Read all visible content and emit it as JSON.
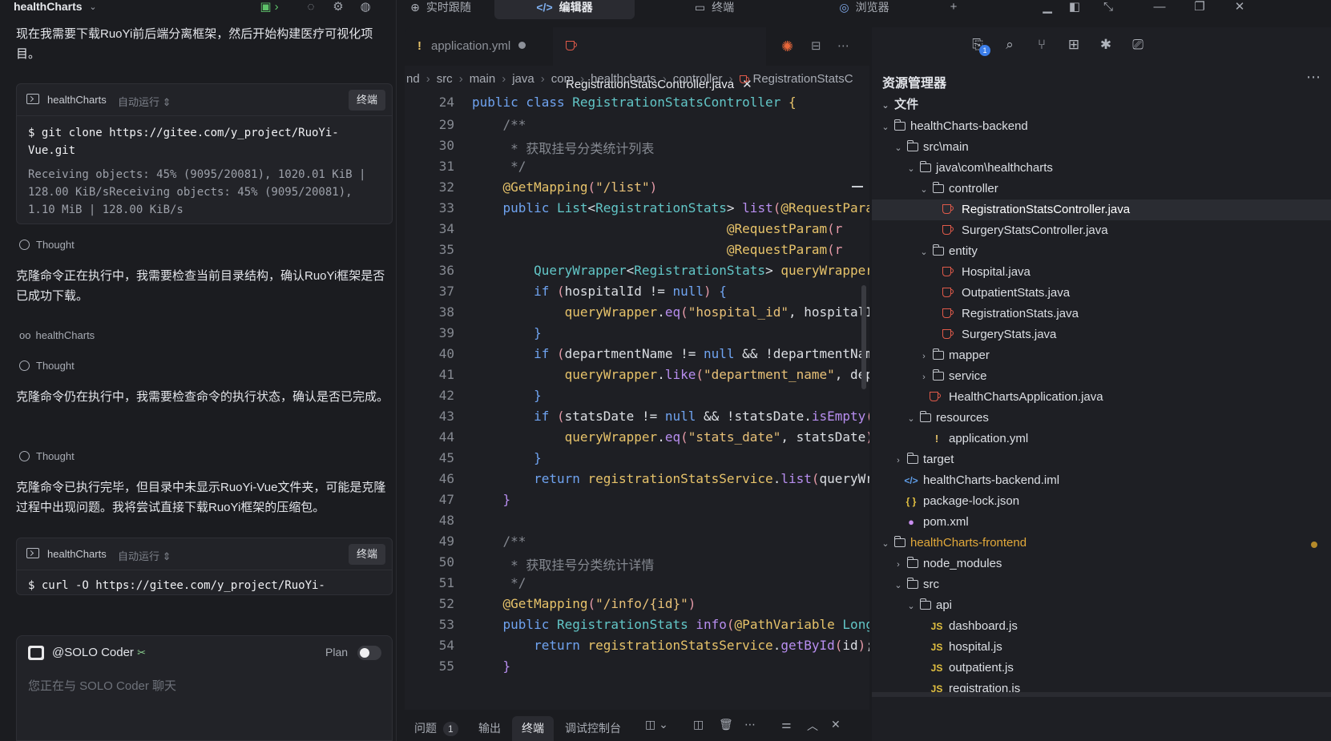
{
  "chat": {
    "title": "healthCharts",
    "message_user": "现在我需要下载RuoYi前后端分离框架，然后开始构建医疗可视化项目。",
    "term1": {
      "name": "healthCharts",
      "mode": "自动运行",
      "button": "终端",
      "cmd": "$ git clone https://gitee.com/y_project/RuoYi-Vue.git",
      "output": "Receiving objects:  45% (9095/20081), 1020.01 KiB | 128.00 KiB/sReceiving objects:  45% (9095/20081), 1.10 MiB | 128.00 KiB/s"
    },
    "thought_label": "Thought",
    "msg1": "克隆命令正在执行中，我需要检查当前目录结构，确认RuoYi框架是否已成功下载。",
    "agent_label": "healthCharts",
    "msg2": "克隆命令仍在执行中，我需要检查命令的执行状态，确认是否已完成。",
    "msg3": "克隆命令已执行完毕，但目录中未显示RuoYi-Vue文件夹，可能是克隆过程中出现问题。我将尝试直接下载RuoYi框架的压缩包。",
    "term2": {
      "name": "healthCharts",
      "mode": "自动运行",
      "button": "终端",
      "cmd": "$ curl -O https://gitee.com/y_project/RuoYi-"
    },
    "input": {
      "agent": "@SOLO Coder",
      "plan_label": "Plan",
      "plan_on": false,
      "placeholder": "您正在与 SOLO Coder 聊天"
    }
  },
  "topbar": {
    "tabs": [
      {
        "label": "实时跟随",
        "icon": "follow-icon"
      },
      {
        "label": "编辑器",
        "icon": "code-icon",
        "active": true
      },
      {
        "label": "终端",
        "icon": "terminal-icon"
      },
      {
        "label": "浏览器",
        "icon": "browser-icon"
      }
    ],
    "add": "+"
  },
  "editor": {
    "tabs": [
      {
        "label": "application.yml",
        "modified": true
      },
      {
        "label": "RegistrationStatsController.java",
        "active": true
      }
    ],
    "breadcrumb": [
      "nd",
      "src",
      "main",
      "java",
      "com",
      "healthcharts",
      "controller",
      "RegistrationStatsC"
    ],
    "lines": [
      24,
      29,
      30,
      31,
      32,
      33,
      34,
      35,
      36,
      37,
      38,
      39,
      40,
      41,
      42,
      43,
      44,
      45,
      46,
      47,
      48,
      49,
      50,
      51,
      52,
      53,
      54,
      55
    ],
    "panel_tabs": [
      {
        "label": "问题",
        "badge": "1"
      },
      {
        "label": "输出"
      },
      {
        "label": "终端",
        "active": true
      },
      {
        "label": "调试控制台"
      }
    ]
  },
  "explorer": {
    "title": "资源管理器",
    "section": "文件",
    "badge": "1",
    "tree": [
      {
        "label": "healthCharts-backend",
        "kind": "folder",
        "open": true
      },
      {
        "label": "src\\main",
        "kind": "folder",
        "open": true
      },
      {
        "label": "java\\com\\healthcharts",
        "kind": "folder",
        "open": true
      },
      {
        "label": "controller",
        "kind": "folder",
        "open": true
      },
      {
        "label": "RegistrationStatsController.java",
        "kind": "java",
        "selected": true
      },
      {
        "label": "SurgeryStatsController.java",
        "kind": "java"
      },
      {
        "label": "entity",
        "kind": "folder",
        "open": true
      },
      {
        "label": "Hospital.java",
        "kind": "java"
      },
      {
        "label": "OutpatientStats.java",
        "kind": "java"
      },
      {
        "label": "RegistrationStats.java",
        "kind": "java"
      },
      {
        "label": "SurgeryStats.java",
        "kind": "java"
      },
      {
        "label": "mapper",
        "kind": "folder",
        "open": false
      },
      {
        "label": "service",
        "kind": "folder",
        "open": false
      },
      {
        "label": "HealthChartsApplication.java",
        "kind": "java"
      },
      {
        "label": "resources",
        "kind": "folder",
        "open": true
      },
      {
        "label": "application.yml",
        "kind": "yml"
      },
      {
        "label": "target",
        "kind": "folder",
        "open": false
      },
      {
        "label": "healthCharts-backend.iml",
        "kind": "xml"
      },
      {
        "label": "package-lock.json",
        "kind": "json"
      },
      {
        "label": "pom.xml",
        "kind": "pom"
      },
      {
        "label": "healthCharts-frontend",
        "kind": "folder",
        "open": true,
        "modified": true
      },
      {
        "label": "node_modules",
        "kind": "folder",
        "open": false
      },
      {
        "label": "src",
        "kind": "folder",
        "open": true
      },
      {
        "label": "api",
        "kind": "folder",
        "open": true
      },
      {
        "label": "dashboard.js",
        "kind": "js"
      },
      {
        "label": "hospital.js",
        "kind": "js"
      },
      {
        "label": "outpatient.js",
        "kind": "js"
      },
      {
        "label": "registration.js",
        "kind": "js"
      }
    ]
  }
}
